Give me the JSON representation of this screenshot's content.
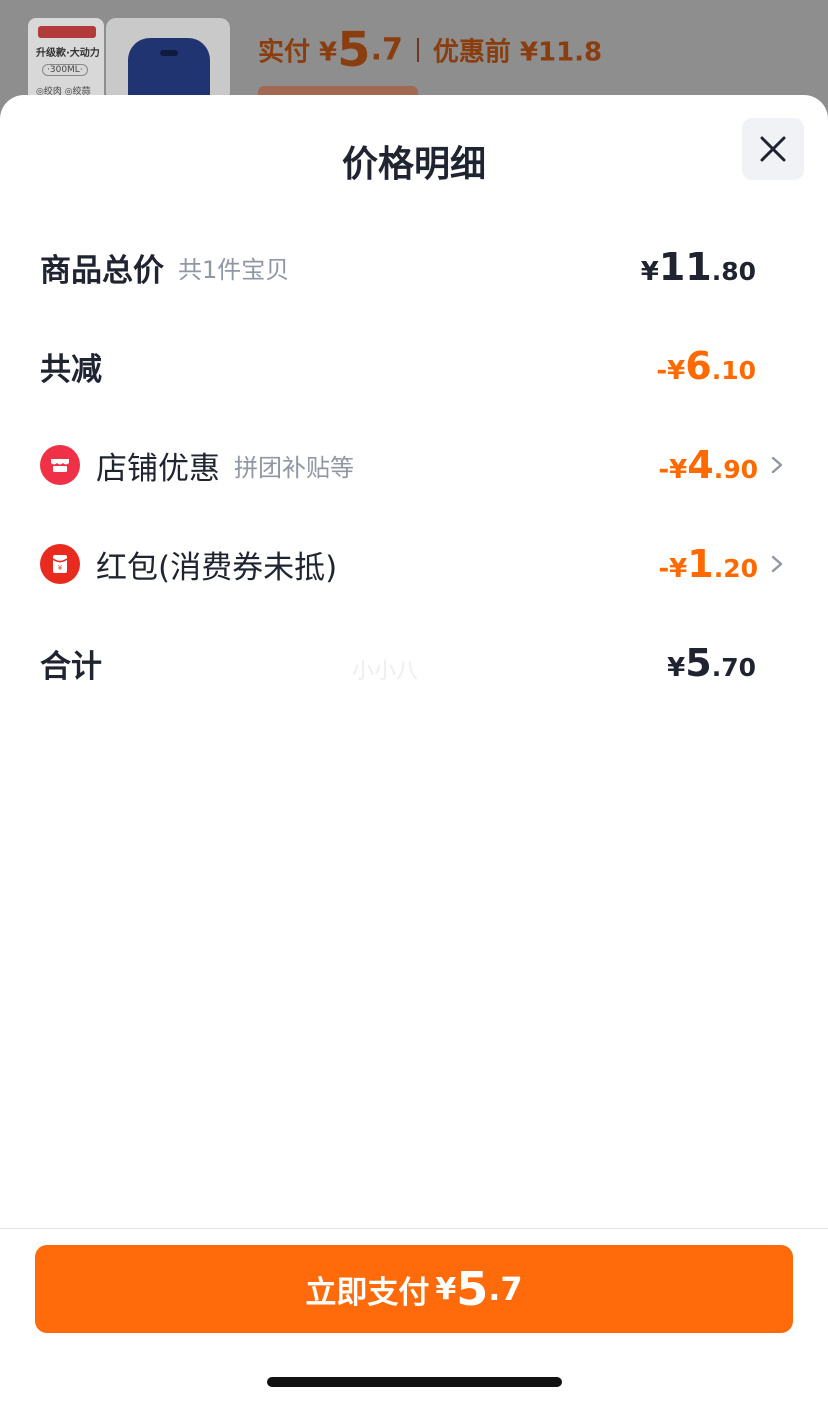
{
  "background": {
    "thumb": {
      "line1": "升级款·大动力",
      "line2": "·300ML·",
      "line3": "◎绞肉 ◎绞蒜"
    },
    "price_label": "实付 ¥",
    "price_int": "5",
    "price_dec": ".7",
    "orig_label": "优惠前 ¥11.8"
  },
  "sheet": {
    "title": "价格明细",
    "rows": {
      "total": {
        "label": "商品总价",
        "sub": "共1件宝贝",
        "cur": "¥",
        "int": "11",
        "dec": ".80"
      },
      "discount": {
        "label": "共减",
        "cur": "-¥",
        "int": "6",
        "dec": ".10"
      },
      "shop": {
        "label": "店铺优惠",
        "sub": "拼团补贴等",
        "cur": "-¥",
        "int": "4",
        "dec": ".90"
      },
      "redpacket": {
        "label": "红包(消费券未抵)",
        "cur": "-¥",
        "int": "1",
        "dec": ".20"
      },
      "sum": {
        "label": "合计",
        "cur": "¥",
        "int": "5",
        "dec": ".70"
      }
    },
    "watermark": "小小八"
  },
  "pay_button": {
    "label": "立即支付",
    "cur": "¥",
    "int": "5",
    "dec": ".7"
  },
  "colors": {
    "accent": "#ff6a00",
    "text": "#1f2430",
    "subtext": "#9097a3",
    "shop_icon": "#f03046",
    "redpacket_icon": "#e82b1e"
  }
}
